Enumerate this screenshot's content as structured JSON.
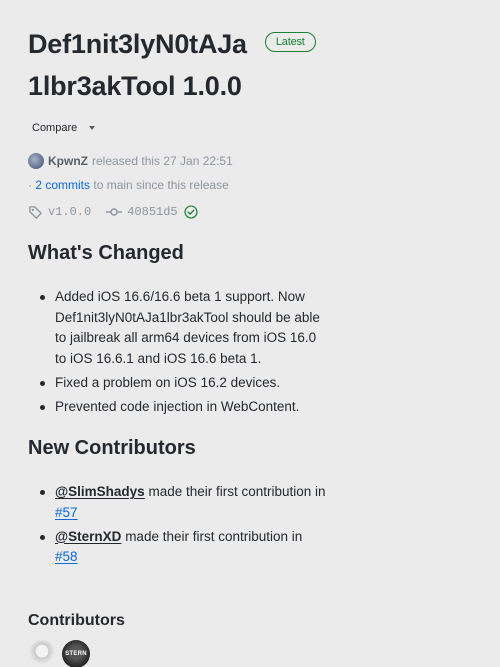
{
  "release": {
    "title_line1": "Def1nit3lyN0tAJa",
    "title_line2": "1lbr3akTool 1.0.0",
    "badge": "Latest",
    "compare_label": "Compare",
    "author": "KpwnZ",
    "released_text": "released this 27 Jan 22:51",
    "commits_prefix": "·",
    "commits_link": "2 commits",
    "commits_suffix": "to main since this release",
    "tag": "v1.0.0",
    "commit_sha": "40851d5"
  },
  "whats_changed": {
    "heading": "What's Changed",
    "items": [
      "Added iOS 16.6/16.6 beta 1 support. Now Def1nit3lyN0tAJa1lbr3akTool should be able to jailbreak all arm64 devices from iOS 16.0 to iOS 16.6.1 and iOS 16.6 beta 1.",
      "Fixed a problem on iOS 16.2 devices.",
      "Prevented code injection in WebContent."
    ]
  },
  "new_contributors": {
    "heading": "New Contributors",
    "items": [
      {
        "mention": "@SlimShadys",
        "text_mid": " made their first contribution in ",
        "pr": "#57"
      },
      {
        "mention": "@SternXD",
        "text_mid": " made their first contribution in ",
        "pr": "#58"
      }
    ]
  },
  "contributors": {
    "heading": "Contributors",
    "avatar2_text": "STERN"
  },
  "colors": {
    "background": "#ebebeb",
    "link": "#0969da",
    "latest_badge": "#1a7f37",
    "text": "#24292f",
    "muted": "#8c959f"
  },
  "icons": [
    "tag-icon",
    "git-commit-icon",
    "verified-check-icon",
    "caret-down-icon"
  ]
}
